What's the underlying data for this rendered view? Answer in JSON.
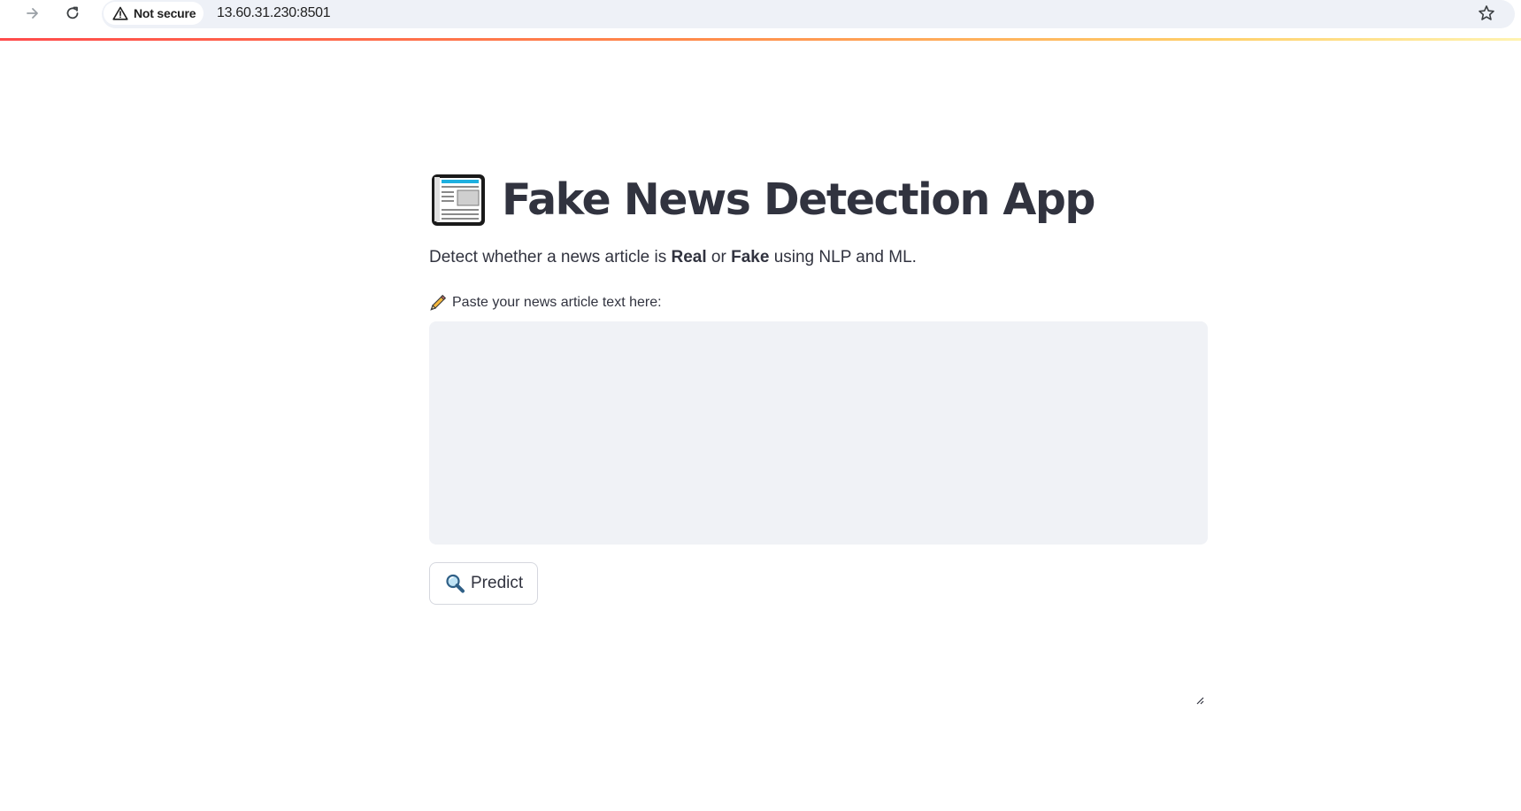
{
  "browser": {
    "security_label": "Not secure",
    "url": "13.60.31.230:8501",
    "forward_icon": "arrow-right-icon",
    "reload_icon": "reload-icon",
    "warning_icon": "warning-triangle-icon",
    "bookmark_icon": "star-icon"
  },
  "app": {
    "title_icon": "newspaper-icon",
    "title": "Fake News Detection App",
    "subtitle": {
      "prefix": "Detect whether a news article is ",
      "real": "Real",
      "or": " or ",
      "fake": "Fake",
      "suffix": " using NLP and ML."
    },
    "input": {
      "label_icon": "pencil-icon",
      "label": "Paste your news article text here:",
      "value": ""
    },
    "predict_button": {
      "icon": "magnifying-glass-icon",
      "label": "Predict"
    }
  },
  "colors": {
    "text": "#31333f",
    "textarea_bg": "#f0f2f6",
    "accent_start": "#ff4b4b",
    "accent_end": "#fff3b0"
  }
}
